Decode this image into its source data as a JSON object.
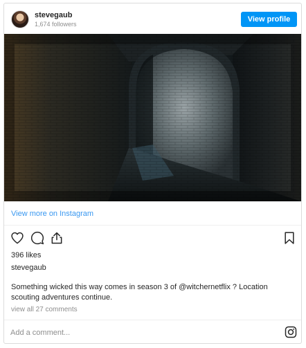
{
  "header": {
    "username": "stevegaub",
    "followers": "1,674 followers",
    "view_profile_label": "View profile"
  },
  "photo": {
    "subject": "dark brick tunnel archway"
  },
  "links": {
    "view_more": "View more on Instagram"
  },
  "actions": {
    "icons": [
      "heart-icon",
      "comment-icon",
      "share-icon",
      "bookmark-icon"
    ]
  },
  "post": {
    "likes": "396 likes",
    "owner": "stevegaub",
    "caption_pre": "Something wicked this way comes in season 3 of ",
    "caption_mention": "@witchernetflix",
    "caption_post": " ? Location scouting adventures continue.",
    "view_comments": "view all 27 comments"
  },
  "comment_box": {
    "placeholder": "Add a comment...",
    "value": ""
  },
  "colors": {
    "accent": "#0095f6",
    "link": "#3897f0",
    "muted": "#8e8e8e",
    "text": "#262626"
  }
}
